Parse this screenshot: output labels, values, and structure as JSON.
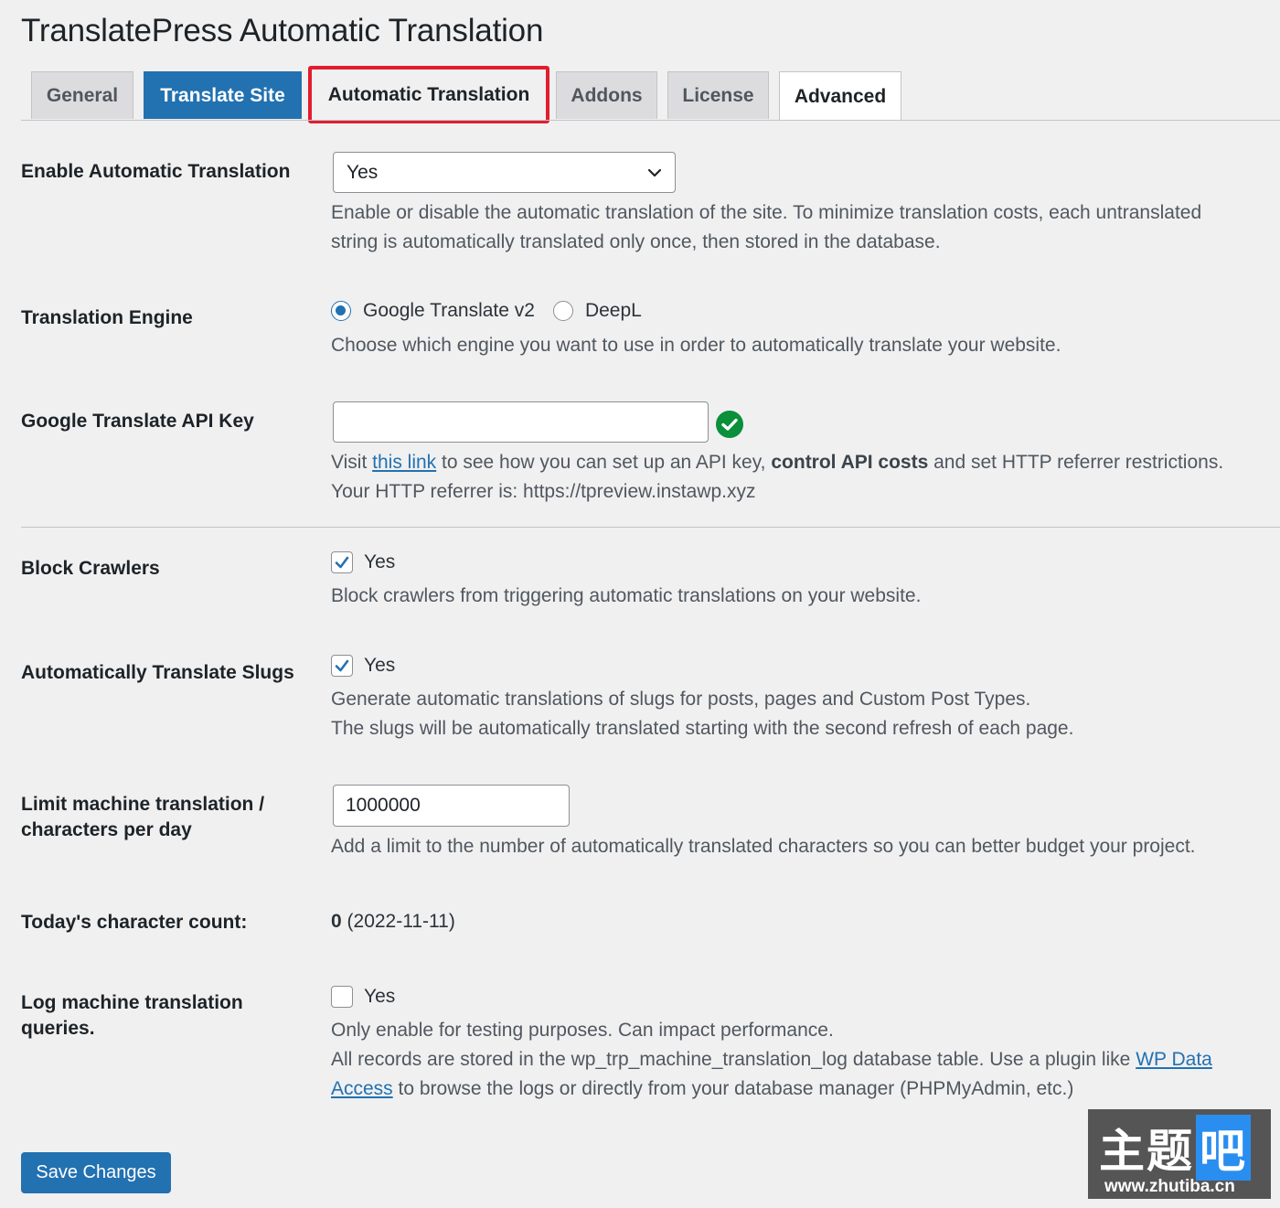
{
  "page": {
    "title": "TranslatePress Automatic Translation"
  },
  "tabs": [
    {
      "label": "General"
    },
    {
      "label": "Translate Site"
    },
    {
      "label": "Automatic Translation"
    },
    {
      "label": "Addons"
    },
    {
      "label": "License"
    },
    {
      "label": "Advanced"
    }
  ],
  "colors": {
    "accent": "#2271b1",
    "highlight": "#e11d2e",
    "success": "#0a8f3a"
  },
  "enable_auto": {
    "label": "Enable Automatic Translation",
    "value": "Yes",
    "desc_line1": "Enable or disable the automatic translation of the site. To minimize translation costs, each untranslated",
    "desc_line2": "string is automatically translated only once, then stored in the database."
  },
  "engine": {
    "label": "Translation Engine",
    "options": [
      "Google Translate v2",
      "DeepL"
    ],
    "selected": "Google Translate v2",
    "desc": "Choose which engine you want to use in order to automatically translate your website."
  },
  "api_key": {
    "label": "Google Translate API Key",
    "value": "",
    "status_icon": "check-circle-icon",
    "desc_pre": "Visit",
    "link_text": "this link",
    "desc_mid": "to see how you can set up an API key,",
    "desc_bold": "control API costs",
    "desc_post": "and set HTTP referrer restrictions.",
    "referrer": "Your HTTP referrer is: https://tpreview.instawp.xyz"
  },
  "block_crawlers": {
    "label": "Block Crawlers",
    "checked": true,
    "option": "Yes",
    "desc": "Block crawlers from triggering automatic translations on your website."
  },
  "slugs": {
    "label": "Automatically Translate Slugs",
    "checked": true,
    "option": "Yes",
    "desc_line1": "Generate automatic translations of slugs for posts, pages and Custom Post Types.",
    "desc_line2": "The slugs will be automatically translated starting with the second refresh of each page."
  },
  "limit": {
    "label_line1": "Limit machine translation /",
    "label_line2": "characters per day",
    "value": "1000000",
    "desc": "Add a limit to the number of automatically translated characters so you can better budget your project."
  },
  "count": {
    "label": "Today's character count:",
    "value": "0",
    "date": "(2022-11-11)"
  },
  "log": {
    "label_line1": "Log machine translation",
    "label_line2": "queries.",
    "checked": false,
    "option": "Yes",
    "desc_line1": "Only enable for testing purposes. Can impact performance.",
    "desc_line2_pre": "All records are stored in the wp_trp_machine_translation_log database table. Use a plugin like",
    "link_part1": "WP Data",
    "link_part2": "Access",
    "desc_line3_post": "to browse the logs or directly from your database manager (PHPMyAdmin, etc.)"
  },
  "save": {
    "label": "Save Changes"
  },
  "watermark": {
    "logo_main": "主题",
    "logo_accent": "吧",
    "url": "www.zhutiba.cn"
  }
}
